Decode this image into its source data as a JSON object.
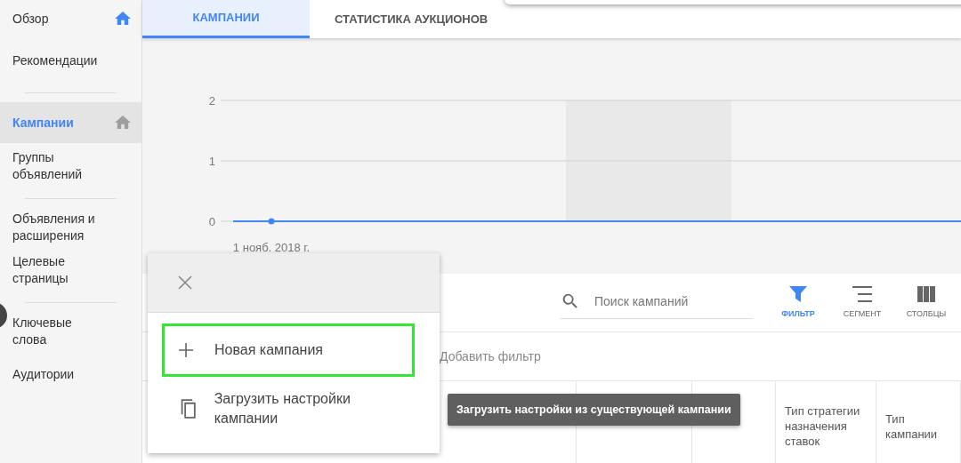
{
  "sidebar": {
    "items": [
      {
        "label": "Обзор",
        "selected": false,
        "home_active": true
      },
      {
        "label": "Рекомендации",
        "selected": false,
        "divider_after": true
      },
      {
        "label": "Кампании",
        "selected": true,
        "home_active": false
      },
      {
        "label": "Группы объявлений",
        "selected": false,
        "divider_after": true
      },
      {
        "label": "Объявления и расширения",
        "selected": false
      },
      {
        "label": "Целевые страницы",
        "selected": false,
        "divider_after": true
      },
      {
        "label": "Ключевые слова",
        "selected": false
      },
      {
        "label": "Аудитории",
        "selected": false
      }
    ]
  },
  "tabs": [
    {
      "label": "КАМПАНИИ",
      "selected": true
    },
    {
      "label": "СТАТИСТИКА АУКЦИОНОВ",
      "selected": false
    }
  ],
  "chart_data": {
    "type": "line",
    "x": [
      "1 нояб. 2018 г."
    ],
    "yticks": [
      0,
      1,
      2
    ],
    "ylim": [
      0,
      2
    ],
    "series": [
      {
        "color": "#4285f4",
        "marker": "circle",
        "values": [
          0
        ]
      }
    ]
  },
  "toolbar": {
    "search": {
      "placeholder": "Поиск кампаний"
    },
    "buttons": [
      {
        "kind": "filter",
        "label": "ФИЛЬТР",
        "selected": true
      },
      {
        "kind": "segment",
        "label": "СЕГМЕНТ",
        "selected": false
      },
      {
        "kind": "columns",
        "label": "СТОЛБЦЫ",
        "selected": false
      }
    ]
  },
  "add_filter": "Добавить фильтр",
  "table": {
    "columns": [
      "Тип стратегии назначения ставок",
      "Тип кампании"
    ]
  },
  "menu": {
    "items": [
      {
        "kind": "new",
        "label": "Новая кампания",
        "highlighted": true
      },
      {
        "kind": "copy",
        "label": "Загрузить настройки кампании",
        "highlighted": false
      }
    ]
  },
  "tooltip": "Загрузить настройки из существующей кампании"
}
